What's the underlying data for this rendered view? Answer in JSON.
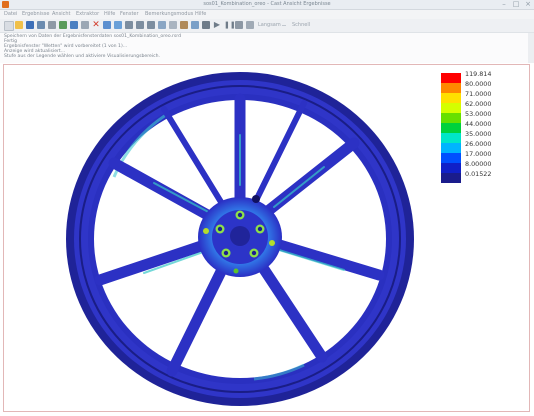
{
  "window": {
    "title": "sos01_Kombination_oreo - Cast Ansicht Ergebnisse"
  },
  "menu": [
    "Datei",
    "Ergebnisse",
    "Ansicht",
    "Extraktor",
    "Hilfe",
    "Fenster",
    "Bemerkungsmodus",
    "Hilfe"
  ],
  "toolbar": {
    "icons": [
      "new-icon",
      "open-icon",
      "save-icon",
      "export-icon",
      "print-icon",
      "image-icon",
      "view-icon",
      "grid-icon",
      "delete-icon",
      "rotate-icon",
      "pan-icon",
      "zoom-icon",
      "zoom-in-icon",
      "zoom-out-icon",
      "fit-icon",
      "section-icon",
      "measure-icon",
      "probe-icon",
      "cursor-icon",
      "play-icon",
      "pause-icon",
      "stop-icon",
      "step-icon"
    ],
    "speed_label": "Langsam",
    "speed_max": "Schnell"
  },
  "console": {
    "lines": [
      "Speichern von Daten der Ergebnisfensterdaten sos01_Kombination_oreo.rsrd",
      "Fertig",
      "Ergebnisfenster \"Wetten\" wird vorbereitet (1 von 1)...",
      "Anzeige wird aktualisiert...",
      "Stufe aus der Legende wählen und aktiviere Visualisierungsbereich."
    ]
  },
  "legend": {
    "values": [
      "119.814",
      "80.0000",
      "71.0000",
      "62.0000",
      "53.0000",
      "44.0000",
      "35.0000",
      "26.0000",
      "17.0000",
      "8.00000",
      "0.01522"
    ],
    "colors": [
      "#ff0000",
      "#ff8800",
      "#ffe000",
      "#d4ff00",
      "#66e000",
      "#00d23c",
      "#00e6c8",
      "#00b4ff",
      "#0050ff",
      "#1020c8",
      "#1a1c8c"
    ]
  },
  "colors": {
    "rim": "#2a2fc4",
    "rim_dark": "#181b86",
    "hotspot": "#39d0c0"
  }
}
